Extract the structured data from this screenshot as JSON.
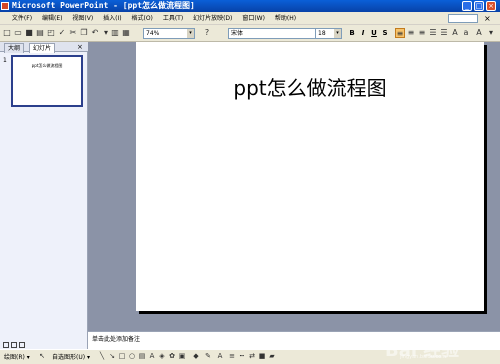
{
  "window": {
    "title": "Microsoft PowerPoint - [ppt怎么做流程图]",
    "min": "_",
    "max": "□",
    "close": "×"
  },
  "menu": [
    "文件(F)",
    "编辑(E)",
    "视图(V)",
    "插入(I)",
    "格式(O)",
    "工具(T)",
    "幻灯片放映(D)",
    "窗口(W)",
    "帮助(H)"
  ],
  "toolbar": {
    "zoom": "74%",
    "font": "宋体",
    "size": "18",
    "bold": "B",
    "italic": "I",
    "underline": "U",
    "shadow": "S"
  },
  "pane": {
    "tab_outline": "大纲",
    "tab_slides": "幻灯片",
    "close": "×",
    "slide_number": "1",
    "thumb_title": "ppt怎么做流程图"
  },
  "slide": {
    "title": "ppt怎么做流程图"
  },
  "notes": {
    "placeholder": "单击此处添加备注"
  },
  "drawbar": {
    "draw": "绘图(R) ▾",
    "autoshapes": "自选图形(U) ▾"
  },
  "watermark": {
    "main": "Bai 经验",
    "sub": "jingyan.baidu.com"
  },
  "colors": {
    "titlebar": "#0a5fd8",
    "workspace": "#8b93a7",
    "chrome": "#ece9d8"
  }
}
